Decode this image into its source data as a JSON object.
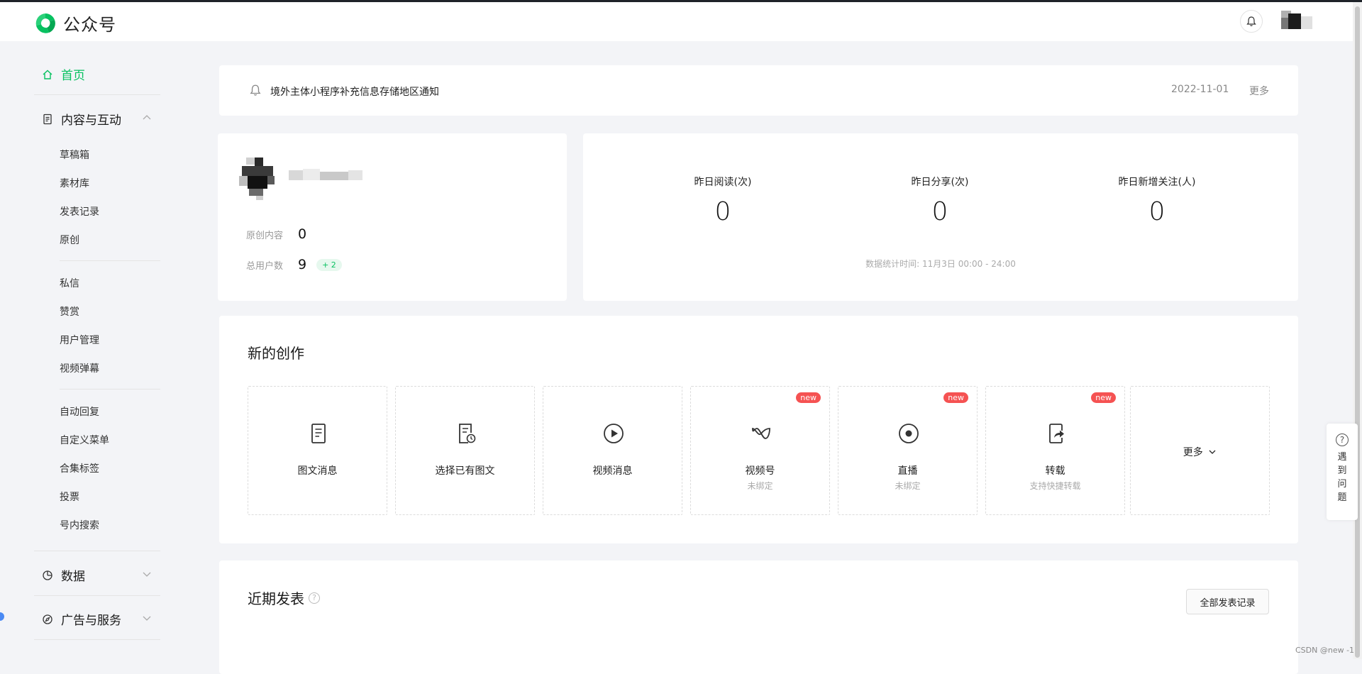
{
  "header": {
    "brand": "公众号"
  },
  "sidebar": {
    "home": "首页",
    "content_group": {
      "label": "内容与互动",
      "items_a": [
        "草稿箱",
        "素材库",
        "发表记录",
        "原创"
      ],
      "items_b": [
        "私信",
        "赞赏",
        "用户管理",
        "视频弹幕"
      ],
      "items_c": [
        "自动回复",
        "自定义菜单",
        "合集标签",
        "投票",
        "号内搜索"
      ]
    },
    "data": "数据",
    "ads": "广告与服务"
  },
  "notice": {
    "text": "境外主体小程序补充信息存储地区通知",
    "date": "2022-11-01",
    "more": "更多"
  },
  "account": {
    "original_label": "原创内容",
    "original_value": "0",
    "users_label": "总用户数",
    "users_value": "9",
    "users_delta": "+ 2"
  },
  "stats": {
    "items": [
      {
        "label": "昨日阅读(次)",
        "value": "0"
      },
      {
        "label": "昨日分享(次)",
        "value": "0"
      },
      {
        "label": "昨日新增关注(人)",
        "value": "0"
      }
    ],
    "footnote": "数据统计时间: 11月3日 00:00 - 24:00"
  },
  "create": {
    "title": "新的创作",
    "badge": "new",
    "tiles": [
      {
        "label": "图文消息",
        "sub": "",
        "icon": "document-icon"
      },
      {
        "label": "选择已有图文",
        "sub": "",
        "icon": "document-clock-icon"
      },
      {
        "label": "视频消息",
        "sub": "",
        "icon": "play-icon"
      },
      {
        "label": "视频号",
        "sub": "未绑定",
        "icon": "channels-icon"
      },
      {
        "label": "直播",
        "sub": "未绑定",
        "icon": "live-icon"
      },
      {
        "label": "转载",
        "sub": "支持快捷转载",
        "icon": "repost-icon"
      }
    ],
    "more": "更多"
  },
  "recent": {
    "title": "近期发表",
    "all_button": "全部发表记录"
  },
  "help_float": "遇到问题",
  "watermark": "CSDN @new -1",
  "colors": {
    "accent": "#07c160",
    "badge": "#f55252",
    "background": "#f3f4f7"
  }
}
